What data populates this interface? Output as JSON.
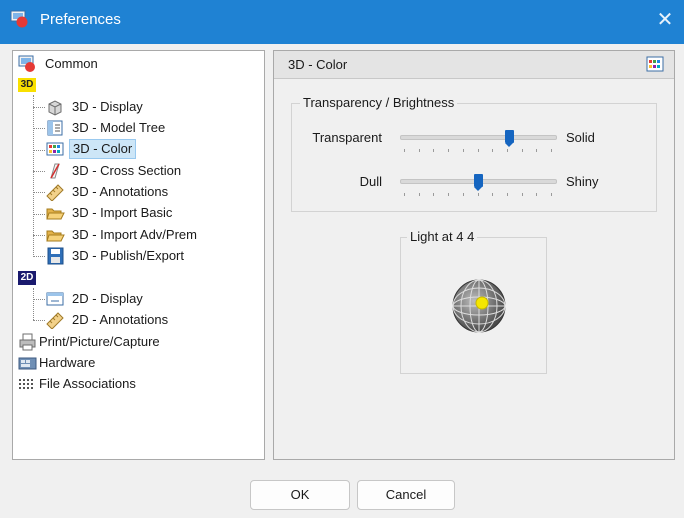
{
  "window": {
    "title": "Preferences",
    "close_glyph": "✕"
  },
  "tree": {
    "items": [
      {
        "label": "Common",
        "icon": "common-icon"
      },
      {
        "label": "3D",
        "icon": "3d-group-icon"
      },
      {
        "label": "3D - Display",
        "icon": "cube-icon"
      },
      {
        "label": "3D - Model Tree",
        "icon": "model-tree-icon"
      },
      {
        "label": "3D - Color",
        "icon": "color-palette-icon",
        "selected": true
      },
      {
        "label": "3D - Cross Section",
        "icon": "cross-section-icon"
      },
      {
        "label": "3D - Annotations",
        "icon": "ruler-icon"
      },
      {
        "label": "3D - Import Basic",
        "icon": "folder-open-icon"
      },
      {
        "label": "3D - Import Adv/Prem",
        "icon": "folder-open-icon"
      },
      {
        "label": "3D - Publish/Export",
        "icon": "floppy-disk-icon"
      },
      {
        "label": "2D",
        "icon": "2d-group-icon"
      },
      {
        "label": "2D - Display",
        "icon": "display-icon"
      },
      {
        "label": "2D - Annotations",
        "icon": "ruler-icon"
      },
      {
        "label": "Print/Picture/Capture",
        "icon": "printer-icon"
      },
      {
        "label": "Hardware",
        "icon": "hardware-icon"
      },
      {
        "label": "File Associations",
        "icon": "file-associations-icon"
      }
    ],
    "badge_3d": "3D",
    "badge_2d": "2D"
  },
  "panel": {
    "header": "3D - Color",
    "group_title": "Transparency / Brightness",
    "transparency": {
      "left_label": "Transparent",
      "right_label": "Solid",
      "value_fraction": 0.7
    },
    "brightness": {
      "left_label": "Dull",
      "right_label": "Shiny",
      "value_fraction": 0.5
    },
    "light_title": "Light at 4 4"
  },
  "buttons": {
    "ok": "OK",
    "cancel": "Cancel"
  },
  "colors": {
    "titlebar": "#1f82d3",
    "slider_thumb": "#1565c0",
    "selection": "#cde6f7",
    "light_dot": "#f5e600"
  }
}
